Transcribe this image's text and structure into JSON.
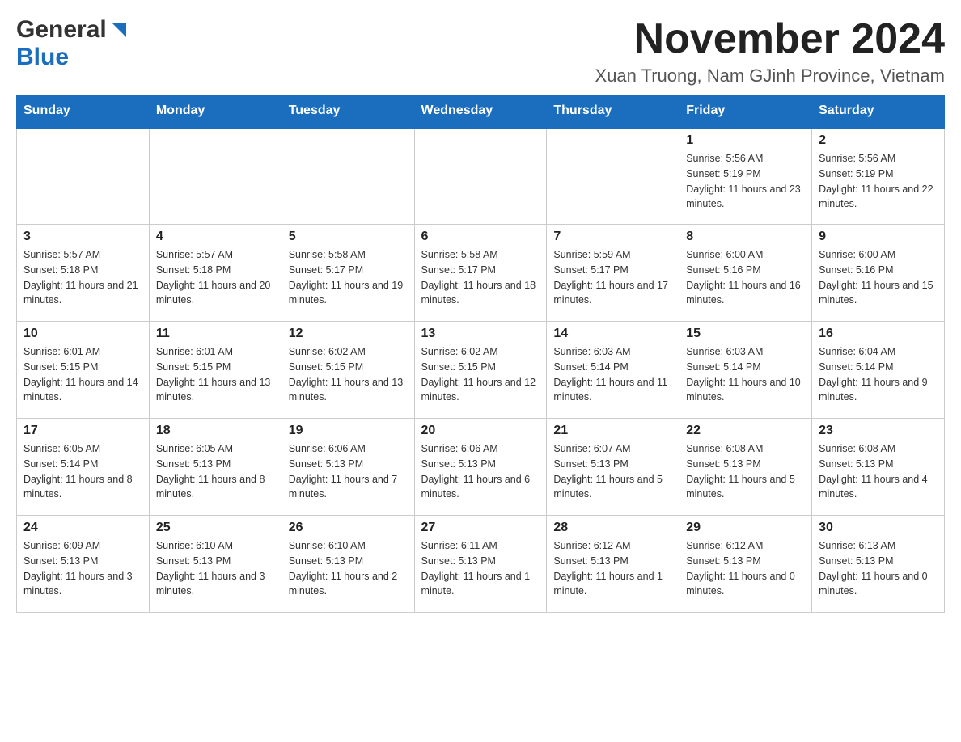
{
  "logo": {
    "general": "General",
    "blue": "Blue"
  },
  "title": {
    "month": "November 2024",
    "location": "Xuan Truong, Nam GJinh Province, Vietnam"
  },
  "days_of_week": [
    "Sunday",
    "Monday",
    "Tuesday",
    "Wednesday",
    "Thursday",
    "Friday",
    "Saturday"
  ],
  "weeks": [
    [
      {
        "day": "",
        "sunrise": "",
        "sunset": "",
        "daylight": ""
      },
      {
        "day": "",
        "sunrise": "",
        "sunset": "",
        "daylight": ""
      },
      {
        "day": "",
        "sunrise": "",
        "sunset": "",
        "daylight": ""
      },
      {
        "day": "",
        "sunrise": "",
        "sunset": "",
        "daylight": ""
      },
      {
        "day": "",
        "sunrise": "",
        "sunset": "",
        "daylight": ""
      },
      {
        "day": "1",
        "sunrise": "Sunrise: 5:56 AM",
        "sunset": "Sunset: 5:19 PM",
        "daylight": "Daylight: 11 hours and 23 minutes."
      },
      {
        "day": "2",
        "sunrise": "Sunrise: 5:56 AM",
        "sunset": "Sunset: 5:19 PM",
        "daylight": "Daylight: 11 hours and 22 minutes."
      }
    ],
    [
      {
        "day": "3",
        "sunrise": "Sunrise: 5:57 AM",
        "sunset": "Sunset: 5:18 PM",
        "daylight": "Daylight: 11 hours and 21 minutes."
      },
      {
        "day": "4",
        "sunrise": "Sunrise: 5:57 AM",
        "sunset": "Sunset: 5:18 PM",
        "daylight": "Daylight: 11 hours and 20 minutes."
      },
      {
        "day": "5",
        "sunrise": "Sunrise: 5:58 AM",
        "sunset": "Sunset: 5:17 PM",
        "daylight": "Daylight: 11 hours and 19 minutes."
      },
      {
        "day": "6",
        "sunrise": "Sunrise: 5:58 AM",
        "sunset": "Sunset: 5:17 PM",
        "daylight": "Daylight: 11 hours and 18 minutes."
      },
      {
        "day": "7",
        "sunrise": "Sunrise: 5:59 AM",
        "sunset": "Sunset: 5:17 PM",
        "daylight": "Daylight: 11 hours and 17 minutes."
      },
      {
        "day": "8",
        "sunrise": "Sunrise: 6:00 AM",
        "sunset": "Sunset: 5:16 PM",
        "daylight": "Daylight: 11 hours and 16 minutes."
      },
      {
        "day": "9",
        "sunrise": "Sunrise: 6:00 AM",
        "sunset": "Sunset: 5:16 PM",
        "daylight": "Daylight: 11 hours and 15 minutes."
      }
    ],
    [
      {
        "day": "10",
        "sunrise": "Sunrise: 6:01 AM",
        "sunset": "Sunset: 5:15 PM",
        "daylight": "Daylight: 11 hours and 14 minutes."
      },
      {
        "day": "11",
        "sunrise": "Sunrise: 6:01 AM",
        "sunset": "Sunset: 5:15 PM",
        "daylight": "Daylight: 11 hours and 13 minutes."
      },
      {
        "day": "12",
        "sunrise": "Sunrise: 6:02 AM",
        "sunset": "Sunset: 5:15 PM",
        "daylight": "Daylight: 11 hours and 13 minutes."
      },
      {
        "day": "13",
        "sunrise": "Sunrise: 6:02 AM",
        "sunset": "Sunset: 5:15 PM",
        "daylight": "Daylight: 11 hours and 12 minutes."
      },
      {
        "day": "14",
        "sunrise": "Sunrise: 6:03 AM",
        "sunset": "Sunset: 5:14 PM",
        "daylight": "Daylight: 11 hours and 11 minutes."
      },
      {
        "day": "15",
        "sunrise": "Sunrise: 6:03 AM",
        "sunset": "Sunset: 5:14 PM",
        "daylight": "Daylight: 11 hours and 10 minutes."
      },
      {
        "day": "16",
        "sunrise": "Sunrise: 6:04 AM",
        "sunset": "Sunset: 5:14 PM",
        "daylight": "Daylight: 11 hours and 9 minutes."
      }
    ],
    [
      {
        "day": "17",
        "sunrise": "Sunrise: 6:05 AM",
        "sunset": "Sunset: 5:14 PM",
        "daylight": "Daylight: 11 hours and 8 minutes."
      },
      {
        "day": "18",
        "sunrise": "Sunrise: 6:05 AM",
        "sunset": "Sunset: 5:13 PM",
        "daylight": "Daylight: 11 hours and 8 minutes."
      },
      {
        "day": "19",
        "sunrise": "Sunrise: 6:06 AM",
        "sunset": "Sunset: 5:13 PM",
        "daylight": "Daylight: 11 hours and 7 minutes."
      },
      {
        "day": "20",
        "sunrise": "Sunrise: 6:06 AM",
        "sunset": "Sunset: 5:13 PM",
        "daylight": "Daylight: 11 hours and 6 minutes."
      },
      {
        "day": "21",
        "sunrise": "Sunrise: 6:07 AM",
        "sunset": "Sunset: 5:13 PM",
        "daylight": "Daylight: 11 hours and 5 minutes."
      },
      {
        "day": "22",
        "sunrise": "Sunrise: 6:08 AM",
        "sunset": "Sunset: 5:13 PM",
        "daylight": "Daylight: 11 hours and 5 minutes."
      },
      {
        "day": "23",
        "sunrise": "Sunrise: 6:08 AM",
        "sunset": "Sunset: 5:13 PM",
        "daylight": "Daylight: 11 hours and 4 minutes."
      }
    ],
    [
      {
        "day": "24",
        "sunrise": "Sunrise: 6:09 AM",
        "sunset": "Sunset: 5:13 PM",
        "daylight": "Daylight: 11 hours and 3 minutes."
      },
      {
        "day": "25",
        "sunrise": "Sunrise: 6:10 AM",
        "sunset": "Sunset: 5:13 PM",
        "daylight": "Daylight: 11 hours and 3 minutes."
      },
      {
        "day": "26",
        "sunrise": "Sunrise: 6:10 AM",
        "sunset": "Sunset: 5:13 PM",
        "daylight": "Daylight: 11 hours and 2 minutes."
      },
      {
        "day": "27",
        "sunrise": "Sunrise: 6:11 AM",
        "sunset": "Sunset: 5:13 PM",
        "daylight": "Daylight: 11 hours and 1 minute."
      },
      {
        "day": "28",
        "sunrise": "Sunrise: 6:12 AM",
        "sunset": "Sunset: 5:13 PM",
        "daylight": "Daylight: 11 hours and 1 minute."
      },
      {
        "day": "29",
        "sunrise": "Sunrise: 6:12 AM",
        "sunset": "Sunset: 5:13 PM",
        "daylight": "Daylight: 11 hours and 0 minutes."
      },
      {
        "day": "30",
        "sunrise": "Sunrise: 6:13 AM",
        "sunset": "Sunset: 5:13 PM",
        "daylight": "Daylight: 11 hours and 0 minutes."
      }
    ]
  ]
}
